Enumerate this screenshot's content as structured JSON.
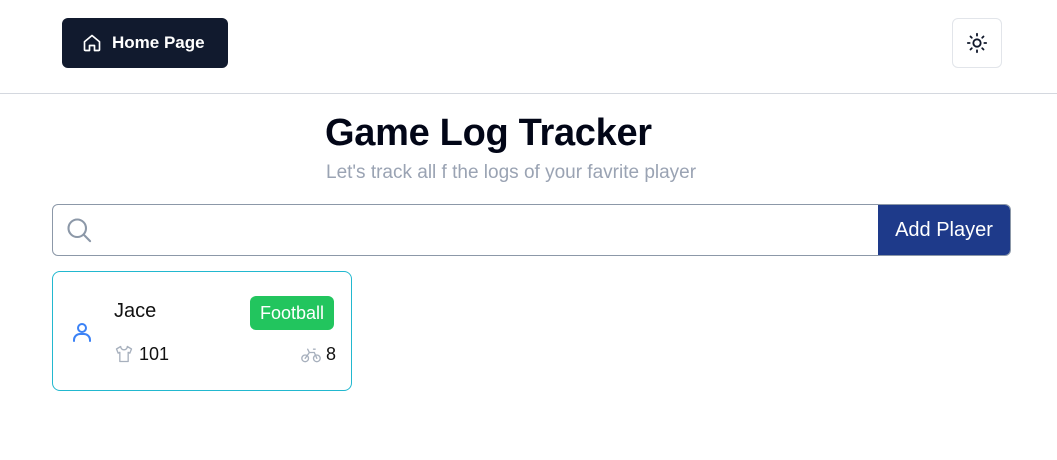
{
  "header": {
    "home_label": "Home Page",
    "home_icon": "home-icon",
    "theme_icon": "sun-icon"
  },
  "main": {
    "title": "Game Log Tracker",
    "subtitle": "Let's track all f the logs of your favrite player"
  },
  "search": {
    "value": "",
    "placeholder": "",
    "add_button_label": "Add Player"
  },
  "players": [
    {
      "name": "Jace",
      "sport": "Football",
      "jersey_number": "101",
      "logs_count": "8",
      "colors": {
        "sport_badge": "#22c55e",
        "card_border": "#22b8cf"
      }
    }
  ],
  "colors": {
    "primary_dark": "#111a2e",
    "accent_blue": "#1e3a8a",
    "muted_text": "#9aa3b3"
  }
}
